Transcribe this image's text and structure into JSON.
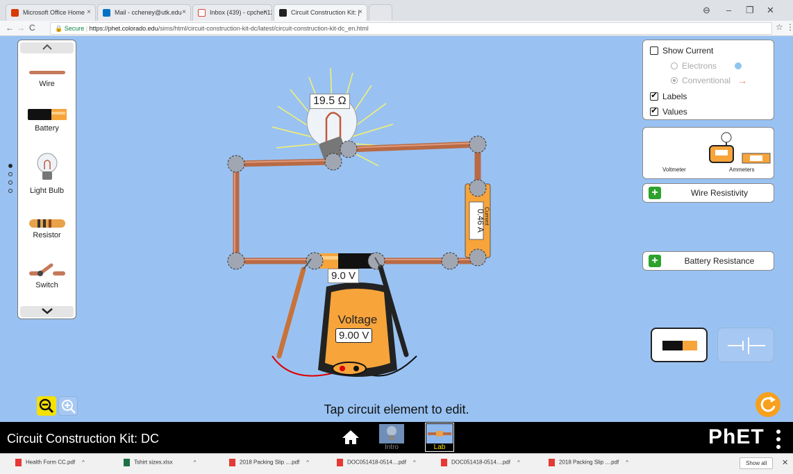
{
  "browser": {
    "tabs": [
      {
        "title": "Microsoft Office Home",
        "color": "#d83b01"
      },
      {
        "title": "Mail - ccheney@utk.edu",
        "color": "#0072c6"
      },
      {
        "title": "Inbox (439) - cpchen12@",
        "color": "#db4437"
      },
      {
        "title": "Circuit Construction Kit: |",
        "color": "#222222"
      }
    ],
    "url_secure": "Secure",
    "url_host": "https://phet.colorado.edu",
    "url_path": "/sims/html/circuit-construction-kit-dc/latest/circuit-construction-kit-dc_en.html"
  },
  "toolbox": {
    "items": [
      {
        "label": "Wire",
        "icon": "wire-icon"
      },
      {
        "label": "Battery",
        "icon": "battery-icon"
      },
      {
        "label": "Light Bulb",
        "icon": "light-bulb-icon"
      },
      {
        "label": "Resistor",
        "icon": "resistor-icon"
      },
      {
        "label": "Switch",
        "icon": "switch-icon"
      }
    ]
  },
  "view_panel": {
    "show_current": "Show Current",
    "electrons": "Electrons",
    "conventional": "Conventional",
    "labels": "Labels",
    "values": "Values"
  },
  "sensors": {
    "voltmeter": "Voltmeter",
    "ammeters": "Ammeters",
    "ammeter_mini": "Current"
  },
  "accordions": {
    "wire_resistivity": "Wire Resistivity",
    "battery_resistance": "Battery Resistance"
  },
  "circuit": {
    "bulb_resistance": "19.5 Ω",
    "battery_voltage": "9.0 V",
    "ammeter_title": "Current",
    "ammeter_reading": "0.46 A",
    "voltmeter_title": "Voltage",
    "voltmeter_reading": "9.00 V"
  },
  "status_text": "Tap circuit element to edit.",
  "navbar": {
    "sim_title": "Circuit Construction Kit: DC",
    "screens": [
      "Intro",
      "Lab"
    ],
    "brand": "PhET"
  },
  "downloads": [
    {
      "name": "Health Form CC.pdf",
      "type": "pdf"
    },
    {
      "name": "Tshirt sizes.xlsx",
      "type": "xls"
    },
    {
      "name": "2018 Packing Slip ....pdf",
      "type": "pdf"
    },
    {
      "name": "DOC051418-0514....pdf",
      "type": "pdf"
    },
    {
      "name": "DOC051418-0514....pdf",
      "type": "pdf"
    },
    {
      "name": "2018 Packing Slip ....pdf",
      "type": "pdf"
    }
  ],
  "show_all": "Show all",
  "colors": {
    "play_area": "#99c2f2",
    "wire": "#b86a45",
    "battery_orange": "#f7a43b",
    "accordion_plus": "#2da22d",
    "reset": "#f7a01d",
    "zoom_active": "#f5e000"
  }
}
